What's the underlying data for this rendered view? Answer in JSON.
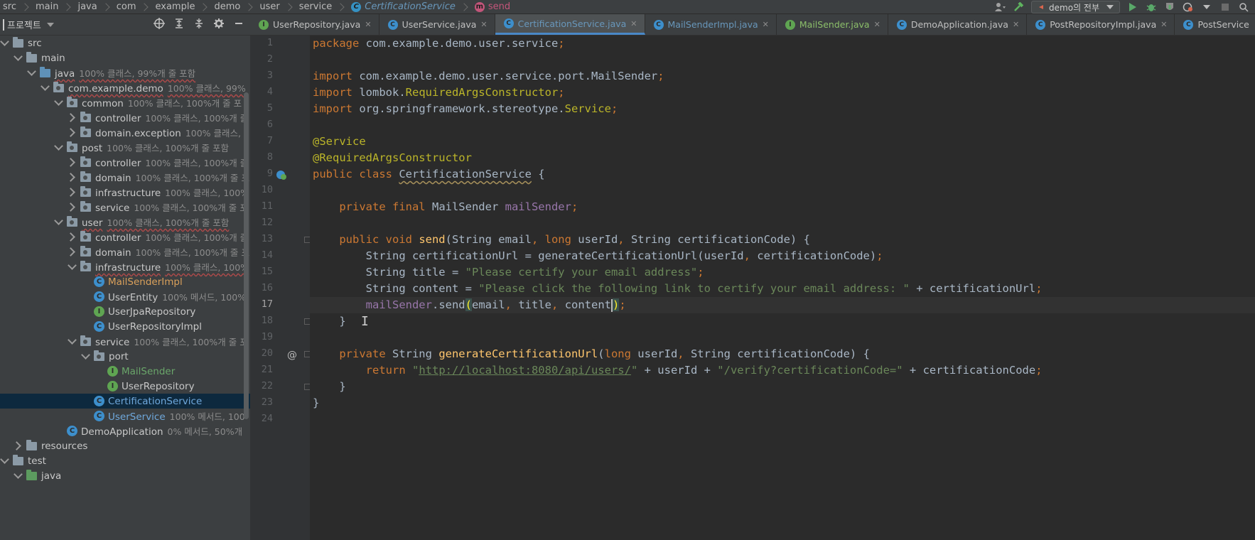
{
  "breadcrumbs": [
    "src",
    "main",
    "java",
    "com",
    "example",
    "demo",
    "user",
    "service"
  ],
  "breadcrumb_class": "CertificationService",
  "breadcrumb_method": "send",
  "run_config": "demo의 전부",
  "project_panel": {
    "title": "프로젝트"
  },
  "tree": [
    {
      "depth": 0,
      "arrow": "open",
      "icon": "folder",
      "label": "src",
      "coverage": ""
    },
    {
      "depth": 1,
      "arrow": "open",
      "icon": "folder",
      "label": "main",
      "coverage": ""
    },
    {
      "depth": 2,
      "arrow": "open",
      "icon": "folder-src",
      "label": "java",
      "coverage": "100% 클래스, 99%개 줄 포함",
      "underline": true
    },
    {
      "depth": 3,
      "arrow": "open",
      "icon": "pkg",
      "label": "com.example.demo",
      "coverage": "100% 클래스, 99%",
      "underline": true
    },
    {
      "depth": 4,
      "arrow": "open",
      "icon": "pkg",
      "label": "common",
      "coverage": "100% 클래스, 100%개 줄 포"
    },
    {
      "depth": 5,
      "arrow": "closed",
      "icon": "pkg",
      "label": "controller",
      "coverage": "100% 클래스, 100%개 줄"
    },
    {
      "depth": 5,
      "arrow": "closed",
      "icon": "pkg",
      "label": "domain.exception",
      "coverage": "100% 클래스, 1"
    },
    {
      "depth": 4,
      "arrow": "open",
      "icon": "pkg",
      "label": "post",
      "coverage": "100% 클래스, 100%개 줄 포함"
    },
    {
      "depth": 5,
      "arrow": "closed",
      "icon": "pkg",
      "label": "controller",
      "coverage": "100% 클래스, 100%개 줄"
    },
    {
      "depth": 5,
      "arrow": "closed",
      "icon": "pkg",
      "label": "domain",
      "coverage": "100% 클래스, 100%개 줄 포"
    },
    {
      "depth": 5,
      "arrow": "closed",
      "icon": "pkg",
      "label": "infrastructure",
      "coverage": "100% 클래스, 100%"
    },
    {
      "depth": 5,
      "arrow": "closed",
      "icon": "pkg",
      "label": "service",
      "coverage": "100% 클래스, 100%개 줄 포"
    },
    {
      "depth": 4,
      "arrow": "open",
      "icon": "pkg",
      "label": "user",
      "coverage": "100% 클래스, 100%개 줄 포함",
      "underline": true
    },
    {
      "depth": 5,
      "arrow": "closed",
      "icon": "pkg",
      "label": "controller",
      "coverage": "100% 클래스, 100%개 줄"
    },
    {
      "depth": 5,
      "arrow": "closed",
      "icon": "pkg",
      "label": "domain",
      "coverage": "100% 클래스, 100%개 줄 포"
    },
    {
      "depth": 5,
      "arrow": "open",
      "icon": "pkg",
      "label": "infrastructure",
      "coverage": "100% 클래스, 100%",
      "underline": true
    },
    {
      "depth": 6,
      "arrow": "none",
      "icon": "class",
      "label": "MailSenderImpl",
      "coverage": "",
      "color": "orange"
    },
    {
      "depth": 6,
      "arrow": "none",
      "icon": "class",
      "label": "UserEntity",
      "coverage": "100% 메서드, 100%"
    },
    {
      "depth": 6,
      "arrow": "none",
      "icon": "interface",
      "label": "UserJpaRepository",
      "coverage": ""
    },
    {
      "depth": 6,
      "arrow": "none",
      "icon": "class",
      "label": "UserRepositoryImpl",
      "coverage": ""
    },
    {
      "depth": 5,
      "arrow": "open",
      "icon": "pkg",
      "label": "service",
      "coverage": "100% 클래스, 100%개 줄 포"
    },
    {
      "depth": 6,
      "arrow": "open",
      "icon": "pkg",
      "label": "port",
      "coverage": ""
    },
    {
      "depth": 7,
      "arrow": "none",
      "icon": "interface",
      "label": "MailSender",
      "coverage": "",
      "color": "green"
    },
    {
      "depth": 7,
      "arrow": "none",
      "icon": "interface",
      "label": "UserRepository",
      "coverage": ""
    },
    {
      "depth": 6,
      "arrow": "none",
      "icon": "class",
      "label": "CertificationService",
      "coverage": "",
      "color": "blue",
      "selected": true
    },
    {
      "depth": 6,
      "arrow": "none",
      "icon": "class",
      "label": "UserService",
      "coverage": "100% 메서드, 100",
      "color": "blue"
    },
    {
      "depth": 4,
      "arrow": "none",
      "icon": "app",
      "label": "DemoApplication",
      "coverage": "0% 메서드, 50%개"
    },
    {
      "depth": 1,
      "arrow": "closed",
      "icon": "folder",
      "label": "resources",
      "coverage": ""
    },
    {
      "depth": 0,
      "arrow": "open",
      "icon": "folder",
      "label": "test",
      "coverage": ""
    },
    {
      "depth": 1,
      "arrow": "open",
      "icon": "folder-test",
      "label": "java",
      "coverage": ""
    }
  ],
  "tabs": [
    {
      "label": "UserRepository.java",
      "icon": "interface",
      "style": "normal"
    },
    {
      "label": "UserService.java",
      "icon": "class",
      "style": "normal"
    },
    {
      "label": "CertificationService.java",
      "icon": "class",
      "style": "active"
    },
    {
      "label": "MailSenderImpl.java",
      "icon": "class",
      "style": "modified"
    },
    {
      "label": "MailSender.java",
      "icon": "interface",
      "style": "green"
    },
    {
      "label": "DemoApplication.java",
      "icon": "app",
      "style": "normal"
    },
    {
      "label": "PostRepositoryImpl.java",
      "icon": "class",
      "style": "normal"
    },
    {
      "label": "PostService",
      "icon": "class",
      "style": "normal"
    }
  ],
  "current_line": 17,
  "code": [
    [
      [
        "kw",
        "package "
      ],
      [
        "",
        "com.example.demo.user.service"
      ],
      [
        "kw",
        ";"
      ]
    ],
    [],
    [
      [
        "kw",
        "import "
      ],
      [
        "",
        "com.example.demo.user.service.port.MailSender"
      ],
      [
        "kw",
        ";"
      ]
    ],
    [
      [
        "kw",
        "import "
      ],
      [
        "",
        "lombok."
      ],
      [
        "ann",
        "RequiredArgsConstructor"
      ],
      [
        "kw",
        ";"
      ]
    ],
    [
      [
        "kw",
        "import "
      ],
      [
        "",
        "org.springframework.stereotype."
      ],
      [
        "ann",
        "Service"
      ],
      [
        "kw",
        ";"
      ]
    ],
    [],
    [
      [
        "ann",
        "@Service"
      ]
    ],
    [
      [
        "ann",
        "@RequiredArgsConstructor"
      ]
    ],
    [
      [
        "kw",
        "public class "
      ],
      [
        "squig",
        "CertificationService"
      ],
      [
        "",
        " {"
      ]
    ],
    [],
    [
      [
        "",
        "    "
      ],
      [
        "kw",
        "private final "
      ],
      [
        "",
        "MailSender "
      ],
      [
        "fld",
        "mailSender"
      ],
      [
        "kw",
        ";"
      ]
    ],
    [],
    [
      [
        "",
        "    "
      ],
      [
        "kw",
        "public void "
      ],
      [
        "fn",
        "send"
      ],
      [
        "",
        "(String email"
      ],
      [
        "kw",
        ", long "
      ],
      [
        "",
        "userId"
      ],
      [
        "kw",
        ", "
      ],
      [
        "",
        "String certificationCode) {"
      ]
    ],
    [
      [
        "",
        "        String certificationUrl = generateCertificationUrl(userId"
      ],
      [
        "kw",
        ", "
      ],
      [
        "",
        "certificationCode)"
      ],
      [
        "kw",
        ";"
      ]
    ],
    [
      [
        "",
        "        String title = "
      ],
      [
        "str",
        "\"Please certify your email address\""
      ],
      [
        "kw",
        ";"
      ]
    ],
    [
      [
        "",
        "        String content = "
      ],
      [
        "str",
        "\"Please click the following link to certify your email address: \""
      ],
      [
        "",
        " + certificationUrl"
      ],
      [
        "kw",
        ";"
      ]
    ],
    [
      [
        "",
        "        "
      ],
      [
        "fld",
        "mailSender"
      ],
      [
        "",
        ".send"
      ],
      [
        "brace",
        "("
      ],
      [
        "",
        "email"
      ],
      [
        "kw",
        ", "
      ],
      [
        "",
        "title"
      ],
      [
        "kw",
        ", "
      ],
      [
        "",
        "content"
      ],
      [
        "caret",
        ""
      ],
      [
        "brace",
        ")"
      ],
      [
        "kw",
        ";"
      ]
    ],
    [
      [
        "",
        "    }"
      ]
    ],
    [],
    [
      [
        "",
        "    "
      ],
      [
        "kw",
        "private "
      ],
      [
        "",
        "String "
      ],
      [
        "fn",
        "generateCertificationUrl"
      ],
      [
        "",
        "("
      ],
      [
        "kw",
        "long "
      ],
      [
        "",
        "userId"
      ],
      [
        "kw",
        ", "
      ],
      [
        "",
        "String certificationCode) {"
      ]
    ],
    [
      [
        "",
        "        "
      ],
      [
        "kw",
        "return "
      ],
      [
        "str",
        "\""
      ],
      [
        "link",
        "http://localhost:8080/api/users/"
      ],
      [
        "str",
        "\""
      ],
      [
        "",
        " + userId + "
      ],
      [
        "str",
        "\"/verify?certificationCode=\""
      ],
      [
        "",
        " + certificationCode"
      ],
      [
        "kw",
        ";"
      ]
    ],
    [
      [
        "",
        "    }"
      ]
    ],
    [
      [
        "",
        "}"
      ]
    ],
    []
  ]
}
